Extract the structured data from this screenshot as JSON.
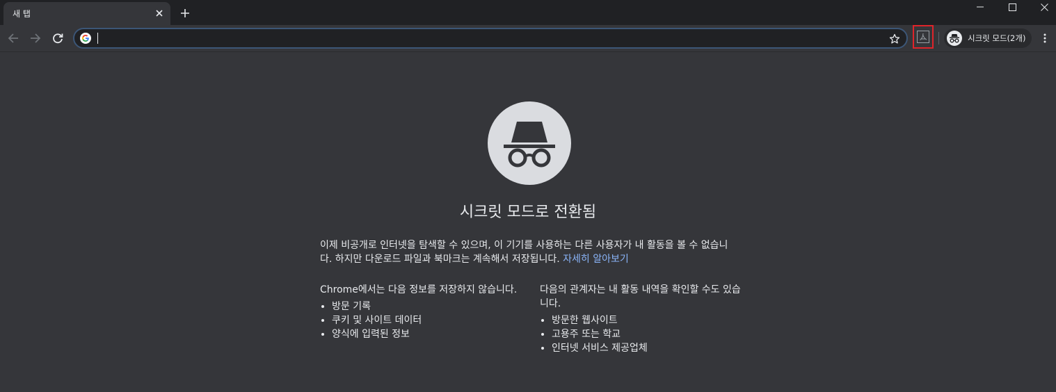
{
  "tab": {
    "title": "새 탭"
  },
  "omnibox": {
    "value": ""
  },
  "profile": {
    "label": "시크릿 모드(2개)"
  },
  "content": {
    "heading": "시크릿 모드로 전환됨",
    "intro": "이제 비공개로 인터넷을 탐색할 수 있으며, 이 기기를 사용하는 다른 사용자가 내 활동을 볼 수 없습니다. 하지만 다운로드 파일과 북마크는 계속해서 저장됩니다. ",
    "learn_more": "자세히 알아보기",
    "left_column": {
      "title": "Chrome에서는 다음 정보를 저장하지 않습니다.",
      "items": [
        "방문 기록",
        "쿠키 및 사이트 데이터",
        "양식에 입력된 정보"
      ]
    },
    "right_column": {
      "title": "다음의 관계자는 내 활동 내역을 확인할 수도 있습니다.",
      "items": [
        "방문한 웹사이트",
        "고용주 또는 학교",
        "인터넷 서비스 제공업체"
      ]
    }
  },
  "icons": {
    "back": "arrow-left-icon",
    "forward": "arrow-right-icon",
    "reload": "reload-icon",
    "star": "star-icon",
    "menu": "kebab-menu-icon",
    "incognito": "incognito-icon",
    "pdf": "pdf-extension-icon"
  },
  "colors": {
    "tabstrip": "#202124",
    "toolbar": "#35363a",
    "omnibox_border": "#3c5677",
    "link": "#8ab4f8",
    "highlight": "#e0242a"
  }
}
